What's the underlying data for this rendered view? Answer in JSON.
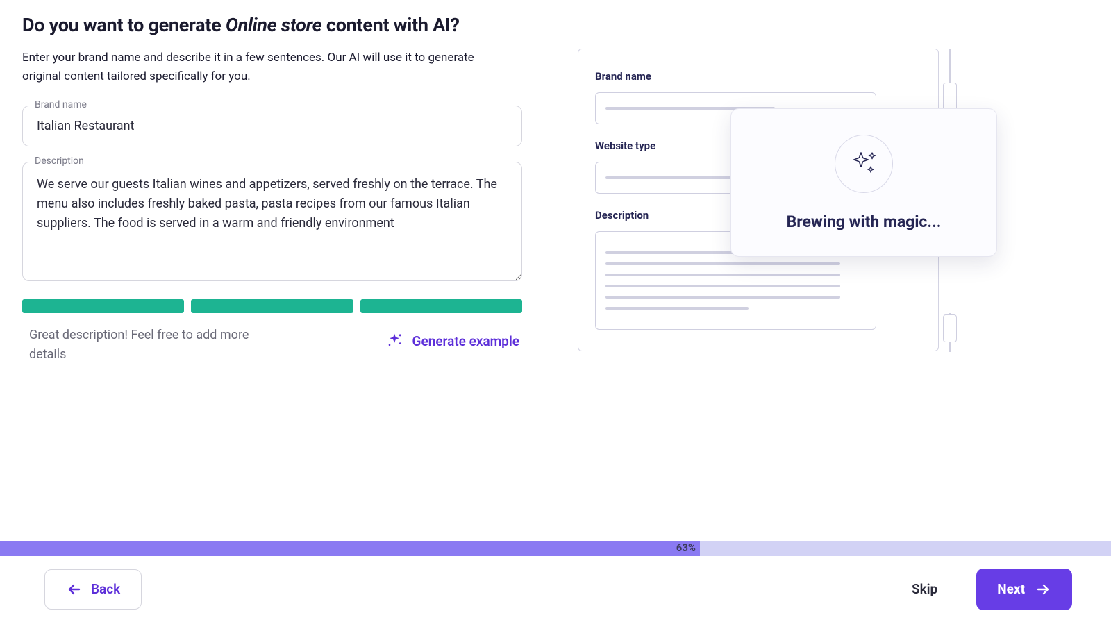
{
  "title": {
    "pre": "Do you want to generate ",
    "italic": "Online store",
    "post": " content with AI?"
  },
  "subtitle": "Enter your brand name and describe it in a few sentences. Our AI will use it to generate original content tailored specifically for you.",
  "fields": {
    "brand_label": "Brand name",
    "brand_value": "Italian Restaurant",
    "desc_label": "Description",
    "desc_value": "We serve our guests Italian wines and appetizers, served freshly on the terrace. The menu also includes freshly baked pasta, pasta recipes from our famous Italian suppliers. The food is served in a warm and friendly environment"
  },
  "hint": "Great description! Feel free to add more details",
  "generate_label": "Generate example",
  "preview": {
    "brand_label": "Brand name",
    "type_label": "Website type",
    "desc_label": "Description",
    "magic_text": "Brewing with magic..."
  },
  "progress": {
    "percent": 63,
    "label": "63%"
  },
  "footer": {
    "back": "Back",
    "skip": "Skip",
    "next": "Next"
  },
  "colors": {
    "accent": "#673de6",
    "teal": "#1db492",
    "progress_bg": "#d2d2f5",
    "progress_fill": "#8a7af2"
  }
}
